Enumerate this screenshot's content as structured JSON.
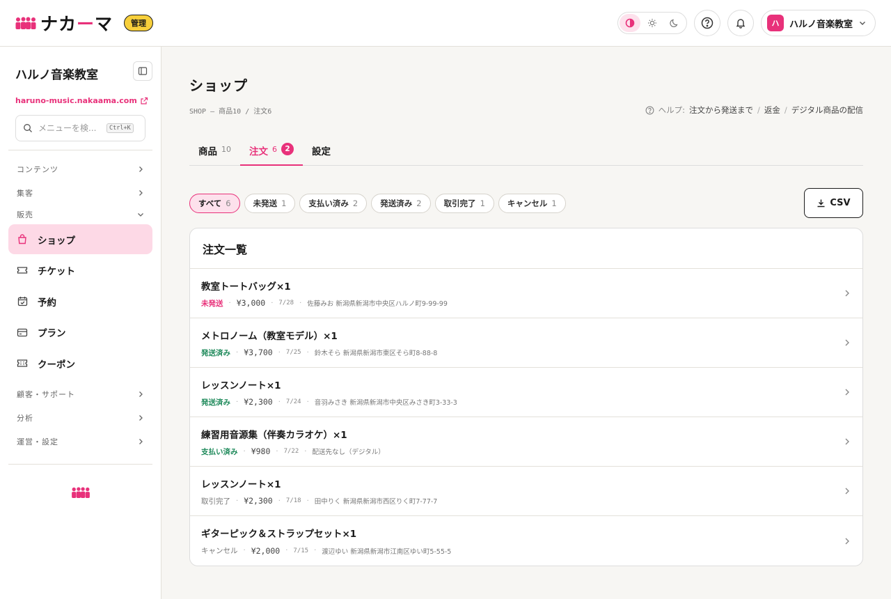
{
  "header": {
    "logo_text": "ナカーマ",
    "admin_label": "管理",
    "account_initial": "ハ",
    "account_name": "ハルノ音楽教室"
  },
  "sidebar": {
    "title": "ハルノ音楽教室",
    "url": "haruno-music.nakaama.com",
    "search_placeholder": "メニューを検...",
    "shortcut": "Ctrl+K",
    "sections": {
      "contents": "コンテンツ",
      "acquisition": "集客",
      "sales": "販売",
      "customer": "顧客・サポート",
      "analytics": "分析",
      "operations": "運営・設定"
    },
    "items": {
      "shop": "ショップ",
      "ticket": "チケット",
      "booking": "予約",
      "plan": "プラン",
      "coupon": "クーポン"
    }
  },
  "page": {
    "title": "ショップ",
    "breadcrumb": "SHOP — 商品10 / 注文6",
    "help_label": "ヘルプ:",
    "help_links": [
      "注文から発送まで",
      "返金",
      "デジタル商品の配信"
    ]
  },
  "tabs": {
    "products_label": "商品",
    "products_count": "10",
    "orders_label": "注文",
    "orders_count": "6",
    "orders_badge": "2",
    "settings_label": "設定"
  },
  "filters": [
    {
      "label": "すべて",
      "count": "6"
    },
    {
      "label": "未発送",
      "count": "1"
    },
    {
      "label": "支払い済み",
      "count": "2"
    },
    {
      "label": "発送済み",
      "count": "2"
    },
    {
      "label": "取引完了",
      "count": "1"
    },
    {
      "label": "キャンセル",
      "count": "1"
    }
  ],
  "csv_label": "CSV",
  "orders": {
    "title": "注文一覧",
    "list": [
      {
        "name": "教室トートバッグ×1",
        "status": "未発送",
        "price": "¥3,000",
        "date": "7/28",
        "address": "佐藤みお 新潟県新潟市中央区ハルノ町9-99-99"
      },
      {
        "name": "メトロノーム（教室モデル）×1",
        "status": "発送済み",
        "price": "¥3,700",
        "date": "7/25",
        "address": "鈴木そら 新潟県新潟市東区そら町8-88-8"
      },
      {
        "name": "レッスンノート×1",
        "status": "発送済み",
        "price": "¥2,300",
        "date": "7/24",
        "address": "音羽みさき 新潟県新潟市中央区みさき町3-33-3"
      },
      {
        "name": "練習用音源集（伴奏カラオケ）×1",
        "status": "支払い済み",
        "price": "¥980",
        "date": "7/22",
        "address": "配送先なし（デジタル）"
      },
      {
        "name": "レッスンノート×1",
        "status": "取引完了",
        "price": "¥2,300",
        "date": "7/18",
        "address": "田中りく 新潟県新潟市西区りく町7-77-7"
      },
      {
        "name": "ギターピック＆ストラップセット×1",
        "status": "キャンセル",
        "price": "¥2,000",
        "date": "7/15",
        "address": "渡辺ゆい 新潟県新潟市江南区ゆい町5-55-5"
      }
    ]
  },
  "colors": {
    "accent": "#e8317a",
    "success": "#1f8a5b",
    "badge": "#f7cf3b"
  }
}
